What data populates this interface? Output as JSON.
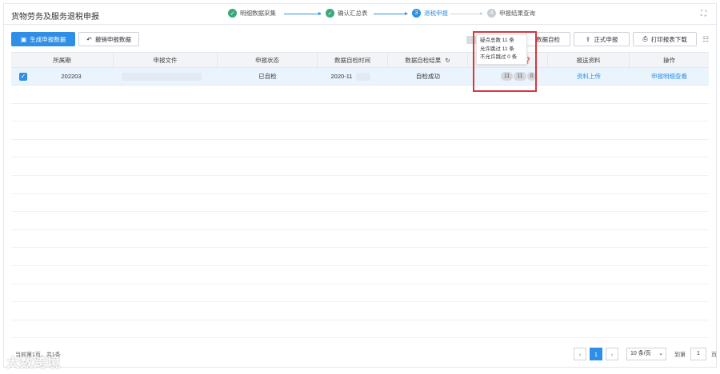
{
  "header": {
    "title": "货物劳务及服务退税申报",
    "steps": [
      {
        "num": "✓",
        "label": "明细数据采集",
        "state": "done"
      },
      {
        "num": "✓",
        "label": "确认汇总表",
        "state": "done"
      },
      {
        "num": "3",
        "label": "退税申报",
        "state": "active"
      },
      {
        "num": "4",
        "label": "申报结果查询",
        "state": "pending"
      }
    ]
  },
  "toolbar": {
    "generate_label": "生成申报数据",
    "revoke_label": "撤销申报数据",
    "self_check_label": "数据自检",
    "formal_label": "正式申报",
    "print_label": "打印报表下载"
  },
  "table": {
    "columns": [
      "所属期",
      "申报文件",
      "申报状态",
      "数据自检时间",
      "数据自检结果",
      "",
      "报送资料",
      "操作"
    ],
    "rows": [
      {
        "period": "202203",
        "file": "",
        "status": "已自检",
        "check_time": "2020-11",
        "check_result": "自检成功",
        "pills": [
          "11",
          "11",
          "0"
        ],
        "upload": "资料上传",
        "action": "申报明细查看"
      }
    ]
  },
  "popover": {
    "lines": [
      "疑点总数 11 条",
      "允许跳过 11 条",
      "不允许跳过 0 条"
    ]
  },
  "footer": {
    "summary": "当前第1页，共1条",
    "current_page": "1",
    "page_size": "10 条/页",
    "goto_label": "到第",
    "goto_value": "1",
    "page_unit": "页"
  },
  "watermark": "大数跨境",
  "colors": {
    "accent": "#2f8ee6",
    "done": "#3aa87a",
    "highlight": "#d9363e"
  }
}
